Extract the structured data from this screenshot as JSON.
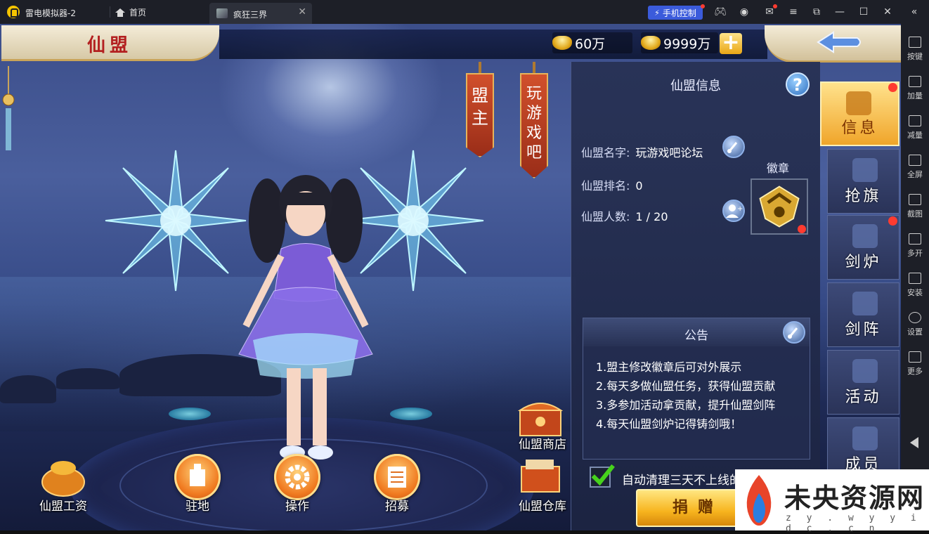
{
  "emulator": {
    "app_name": "雷电模拟器-2",
    "home_tab": "首页",
    "active_tab": "疯狂三界",
    "phone_control": "手机控制",
    "sidebar": [
      "按键",
      "加量",
      "减量",
      "全屏",
      "截图",
      "多开",
      "安装",
      "设置",
      "更多"
    ]
  },
  "game": {
    "title": "仙盟",
    "currency_silver": "60万",
    "currency_gold": "9999万",
    "banners": [
      "盟主",
      "玩游戏吧"
    ],
    "bottom_buttons": {
      "wages": "仙盟工资",
      "base": "驻地",
      "operate": "操作",
      "recruit": "招募",
      "shop": "仙盟商店",
      "warehouse": "仙盟仓库"
    },
    "info": {
      "panel_title": "仙盟信息",
      "help": "?",
      "name_label": "仙盟名字:",
      "name_value": "玩游戏吧论坛",
      "rank_label": "仙盟排名:",
      "rank_value": "0",
      "members_label": "仙盟人数:",
      "members_value": "1 / 20",
      "badge_label": "徽章"
    },
    "notice": {
      "title": "公告",
      "lines": [
        "1.盟主修改徽章后可对外展示",
        "2.每天多做仙盟任务，获得仙盟贡献",
        "3.多参加活动拿贡献，提升仙盟剑阵",
        "4.每天仙盟剑炉记得铸剑哦！"
      ]
    },
    "auto_clean": {
      "checked": true,
      "label": "自动清理三天不上线的玩家"
    },
    "donate_label": "捐赠",
    "side_tabs": [
      "信息",
      "抢旗",
      "剑炉",
      "剑阵",
      "活动",
      "成员"
    ],
    "colors": {
      "accent_gold": "#f0a52a",
      "title_red": "#b32020",
      "panel_bg": "#28324f"
    }
  },
  "watermark": {
    "title": "未央资源网",
    "url": "z y . w y y i d c . c n"
  }
}
